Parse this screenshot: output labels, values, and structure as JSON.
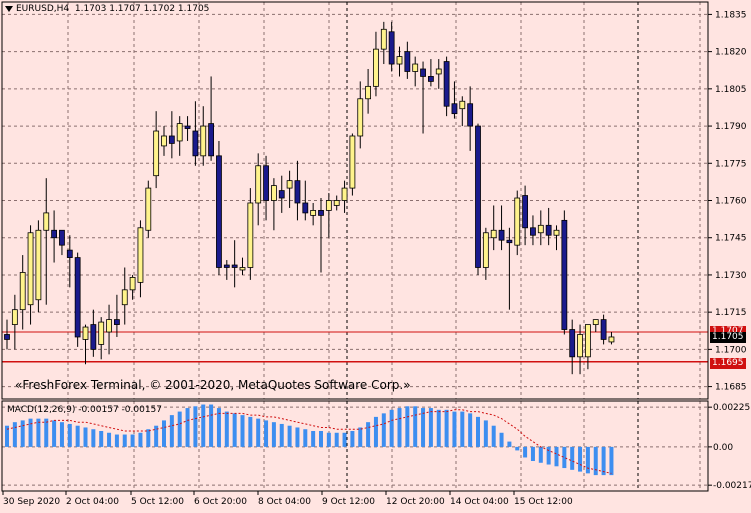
{
  "header": {
    "symbol_timeframe": "EURUSD,H4",
    "ohlc": "1.1703 1.1707 1.1702 1.1705"
  },
  "watermark": "«FreshForex Terminal, © 2001-2020, MetaQuotes Software Corp.»",
  "colors": {
    "background": "#FFE4E1",
    "grid": "#8B6F6F",
    "bull": "#FFF38C",
    "bear": "#1A1A8C",
    "macd_hist": "#3D8EF0",
    "signal": "#D01010",
    "level_line": "#D01010",
    "bid_tag_bg": "#000000"
  },
  "price_axis": {
    "ticks": [
      "1.1835",
      "1.1820",
      "1.1805",
      "1.1790",
      "1.1775",
      "1.1760",
      "1.1745",
      "1.1730",
      "1.1715",
      "1.1700",
      "1.1685"
    ],
    "current_price": "1.1705",
    "level_upper": "1.1707",
    "level_lower": "1.1695"
  },
  "macd": {
    "label": "MACD(12,26,9) -0.00157 -0.00157",
    "ticks": [
      "0.00225",
      "0.00",
      "-0.00217"
    ]
  },
  "time_axis": {
    "labels": [
      "30 Sep 2020",
      "2 Oct 04:00",
      "5 Oct 12:00",
      "6 Oct 20:00",
      "8 Oct 04:00",
      "9 Oct 12:00",
      "12 Oct 20:00",
      "14 Oct 04:00",
      "15 Oct 12:00"
    ]
  },
  "chart_data": {
    "type": "candlestick",
    "title": "EURUSD,H4",
    "ylim": [
      1.168,
      1.184
    ],
    "candles": [
      {
        "o": 1.1706,
        "h": 1.1712,
        "l": 1.17,
        "c": 1.1704
      },
      {
        "o": 1.171,
        "h": 1.1722,
        "l": 1.17,
        "c": 1.1716
      },
      {
        "o": 1.1716,
        "h": 1.1738,
        "l": 1.1708,
        "c": 1.1731
      },
      {
        "o": 1.1718,
        "h": 1.175,
        "l": 1.171,
        "c": 1.1747
      },
      {
        "o": 1.172,
        "h": 1.1752,
        "l": 1.1715,
        "c": 1.1748
      },
      {
        "o": 1.1748,
        "h": 1.1769,
        "l": 1.1718,
        "c": 1.1755
      },
      {
        "o": 1.1748,
        "h": 1.1756,
        "l": 1.1735,
        "c": 1.1745
      },
      {
        "o": 1.1748,
        "h": 1.1742,
        "l": 1.1738,
        "c": 1.1742
      },
      {
        "o": 1.174,
        "h": 1.1746,
        "l": 1.1725,
        "c": 1.1737
      },
      {
        "o": 1.1737,
        "h": 1.1739,
        "l": 1.1701,
        "c": 1.1705
      },
      {
        "o": 1.1704,
        "h": 1.171,
        "l": 1.1694,
        "c": 1.1709
      },
      {
        "o": 1.171,
        "h": 1.1716,
        "l": 1.1697,
        "c": 1.17
      },
      {
        "o": 1.1702,
        "h": 1.1713,
        "l": 1.1696,
        "c": 1.1711
      },
      {
        "o": 1.1707,
        "h": 1.1718,
        "l": 1.1698,
        "c": 1.1712
      },
      {
        "o": 1.1712,
        "h": 1.1722,
        "l": 1.1705,
        "c": 1.171
      },
      {
        "o": 1.1718,
        "h": 1.1733,
        "l": 1.171,
        "c": 1.1724
      },
      {
        "o": 1.1724,
        "h": 1.173,
        "l": 1.172,
        "c": 1.1729
      },
      {
        "o": 1.1727,
        "h": 1.1752,
        "l": 1.1721,
        "c": 1.1749
      },
      {
        "o": 1.1748,
        "h": 1.1768,
        "l": 1.1745,
        "c": 1.1765
      },
      {
        "o": 1.177,
        "h": 1.1796,
        "l": 1.1765,
        "c": 1.1788
      },
      {
        "o": 1.1782,
        "h": 1.179,
        "l": 1.1778,
        "c": 1.1786
      },
      {
        "o": 1.1786,
        "h": 1.1796,
        "l": 1.1777,
        "c": 1.1783
      },
      {
        "o": 1.1784,
        "h": 1.1794,
        "l": 1.1778,
        "c": 1.1791
      },
      {
        "o": 1.179,
        "h": 1.1794,
        "l": 1.1784,
        "c": 1.1789
      },
      {
        "o": 1.1788,
        "h": 1.18,
        "l": 1.1774,
        "c": 1.1778
      },
      {
        "o": 1.1778,
        "h": 1.1798,
        "l": 1.1774,
        "c": 1.179
      },
      {
        "o": 1.1791,
        "h": 1.181,
        "l": 1.1776,
        "c": 1.1778
      },
      {
        "o": 1.1778,
        "h": 1.1784,
        "l": 1.173,
        "c": 1.1733
      },
      {
        "o": 1.1734,
        "h": 1.1736,
        "l": 1.1728,
        "c": 1.1733
      },
      {
        "o": 1.1734,
        "h": 1.1744,
        "l": 1.1725,
        "c": 1.1733
      },
      {
        "o": 1.1732,
        "h": 1.1737,
        "l": 1.173,
        "c": 1.1733
      },
      {
        "o": 1.1733,
        "h": 1.1765,
        "l": 1.1728,
        "c": 1.1759
      },
      {
        "o": 1.1759,
        "h": 1.1779,
        "l": 1.175,
        "c": 1.1774
      },
      {
        "o": 1.1774,
        "h": 1.1778,
        "l": 1.1752,
        "c": 1.176
      },
      {
        "o": 1.176,
        "h": 1.1769,
        "l": 1.1748,
        "c": 1.1766
      },
      {
        "o": 1.1764,
        "h": 1.177,
        "l": 1.1755,
        "c": 1.1761
      },
      {
        "o": 1.1765,
        "h": 1.1772,
        "l": 1.1757,
        "c": 1.1768
      },
      {
        "o": 1.1768,
        "h": 1.1776,
        "l": 1.1752,
        "c": 1.1759
      },
      {
        "o": 1.1759,
        "h": 1.1768,
        "l": 1.1752,
        "c": 1.1755
      },
      {
        "o": 1.1754,
        "h": 1.1759,
        "l": 1.175,
        "c": 1.1756
      },
      {
        "o": 1.1756,
        "h": 1.1761,
        "l": 1.1731,
        "c": 1.1754
      },
      {
        "o": 1.1756,
        "h": 1.1763,
        "l": 1.1745,
        "c": 1.176
      },
      {
        "o": 1.1758,
        "h": 1.1762,
        "l": 1.1756,
        "c": 1.176
      },
      {
        "o": 1.176,
        "h": 1.1768,
        "l": 1.1755,
        "c": 1.1765
      },
      {
        "o": 1.1765,
        "h": 1.1787,
        "l": 1.1762,
        "c": 1.1786
      },
      {
        "o": 1.1786,
        "h": 1.1808,
        "l": 1.1781,
        "c": 1.1801
      },
      {
        "o": 1.1801,
        "h": 1.1813,
        "l": 1.1795,
        "c": 1.1806
      },
      {
        "o": 1.1806,
        "h": 1.1828,
        "l": 1.1802,
        "c": 1.1821
      },
      {
        "o": 1.1821,
        "h": 1.1832,
        "l": 1.1815,
        "c": 1.1829
      },
      {
        "o": 1.1828,
        "h": 1.1832,
        "l": 1.1812,
        "c": 1.1815
      },
      {
        "o": 1.1815,
        "h": 1.1822,
        "l": 1.181,
        "c": 1.1818
      },
      {
        "o": 1.182,
        "h": 1.1824,
        "l": 1.1809,
        "c": 1.1812
      },
      {
        "o": 1.1812,
        "h": 1.1818,
        "l": 1.1806,
        "c": 1.1815
      },
      {
        "o": 1.1813,
        "h": 1.1816,
        "l": 1.1787,
        "c": 1.181
      },
      {
        "o": 1.181,
        "h": 1.1817,
        "l": 1.1806,
        "c": 1.1808
      },
      {
        "o": 1.1811,
        "h": 1.1817,
        "l": 1.1805,
        "c": 1.1813
      },
      {
        "o": 1.1816,
        "h": 1.1818,
        "l": 1.1794,
        "c": 1.1798
      },
      {
        "o": 1.1799,
        "h": 1.1808,
        "l": 1.1793,
        "c": 1.1795
      },
      {
        "o": 1.1797,
        "h": 1.1802,
        "l": 1.179,
        "c": 1.18
      },
      {
        "o": 1.1799,
        "h": 1.1806,
        "l": 1.178,
        "c": 1.179
      },
      {
        "o": 1.179,
        "h": 1.1791,
        "l": 1.173,
        "c": 1.1733
      },
      {
        "o": 1.1733,
        "h": 1.1749,
        "l": 1.1728,
        "c": 1.1747
      },
      {
        "o": 1.1745,
        "h": 1.1758,
        "l": 1.174,
        "c": 1.1748
      },
      {
        "o": 1.1748,
        "h": 1.1758,
        "l": 1.174,
        "c": 1.1744
      },
      {
        "o": 1.1744,
        "h": 1.1749,
        "l": 1.1716,
        "c": 1.1743
      },
      {
        "o": 1.1742,
        "h": 1.1764,
        "l": 1.1738,
        "c": 1.1761
      },
      {
        "o": 1.1762,
        "h": 1.1766,
        "l": 1.1742,
        "c": 1.1749
      },
      {
        "o": 1.1749,
        "h": 1.1754,
        "l": 1.1742,
        "c": 1.1746
      },
      {
        "o": 1.1747,
        "h": 1.1756,
        "l": 1.1742,
        "c": 1.175
      },
      {
        "o": 1.175,
        "h": 1.1757,
        "l": 1.1742,
        "c": 1.1746
      },
      {
        "o": 1.1746,
        "h": 1.175,
        "l": 1.174,
        "c": 1.1748
      },
      {
        "o": 1.1752,
        "h": 1.1756,
        "l": 1.1706,
        "c": 1.1708
      },
      {
        "o": 1.1708,
        "h": 1.1712,
        "l": 1.169,
        "c": 1.1697
      },
      {
        "o": 1.1697,
        "h": 1.171,
        "l": 1.169,
        "c": 1.1706
      },
      {
        "o": 1.1697,
        "h": 1.171,
        "l": 1.1692,
        "c": 1.171
      },
      {
        "o": 1.171,
        "h": 1.1712,
        "l": 1.1707,
        "c": 1.1712
      },
      {
        "o": 1.1712,
        "h": 1.1714,
        "l": 1.1702,
        "c": 1.1704
      },
      {
        "o": 1.1703,
        "h": 1.1707,
        "l": 1.1702,
        "c": 1.1705
      }
    ],
    "macd_histogram": [
      0.0012,
      0.0014,
      0.0015,
      0.0016,
      0.0016,
      0.0016,
      0.0015,
      0.0014,
      0.0013,
      0.0012,
      0.0011,
      0.001,
      0.0009,
      0.0008,
      0.0007,
      0.0007,
      0.0007,
      0.0008,
      0.001,
      0.0012,
      0.0015,
      0.0018,
      0.002,
      0.0022,
      0.0023,
      0.0024,
      0.0024,
      0.0022,
      0.002,
      0.0019,
      0.0018,
      0.0017,
      0.0016,
      0.0015,
      0.0014,
      0.0013,
      0.0012,
      0.0011,
      0.001,
      0.0009,
      0.0009,
      0.0008,
      0.0008,
      0.0008,
      0.0009,
      0.0011,
      0.0014,
      0.0017,
      0.0019,
      0.0021,
      0.0022,
      0.0023,
      0.0023,
      0.0022,
      0.0022,
      0.0021,
      0.0021,
      0.002,
      0.002,
      0.0019,
      0.0017,
      0.0015,
      0.0012,
      0.0008,
      0.0003,
      -0.0002,
      -0.0006,
      -0.0008,
      -0.0009,
      -0.001,
      -0.0011,
      -0.0012,
      -0.0013,
      -0.0014,
      -0.0015,
      -0.0016,
      -0.0016,
      -0.0016
    ],
    "macd_signal": [
      0.001,
      0.0011,
      0.0012,
      0.0013,
      0.0014,
      0.0014,
      0.0015,
      0.0015,
      0.0015,
      0.0014,
      0.0014,
      0.0013,
      0.0012,
      0.0011,
      0.001,
      0.0009,
      0.0009,
      0.0009,
      0.0009,
      0.001,
      0.0011,
      0.0012,
      0.0013,
      0.0015,
      0.0016,
      0.0017,
      0.0018,
      0.0019,
      0.0019,
      0.0019,
      0.0019,
      0.0018,
      0.0018,
      0.0017,
      0.0017,
      0.0016,
      0.0015,
      0.0014,
      0.0013,
      0.0012,
      0.0011,
      0.0011,
      0.001,
      0.001,
      0.001,
      0.001,
      0.0011,
      0.0012,
      0.0013,
      0.0015,
      0.0016,
      0.0017,
      0.0018,
      0.0019,
      0.002,
      0.002,
      0.002,
      0.0021,
      0.0021,
      0.002,
      0.002,
      0.0019,
      0.0018,
      0.0016,
      0.0013,
      0.001,
      0.0006,
      0.0003,
      0.0,
      -0.0002,
      -0.0004,
      -0.0006,
      -0.0008,
      -0.001,
      -0.0012,
      -0.0013,
      -0.0014,
      -0.0015
    ],
    "macd_ylim": [
      -0.0025,
      0.0026
    ]
  }
}
